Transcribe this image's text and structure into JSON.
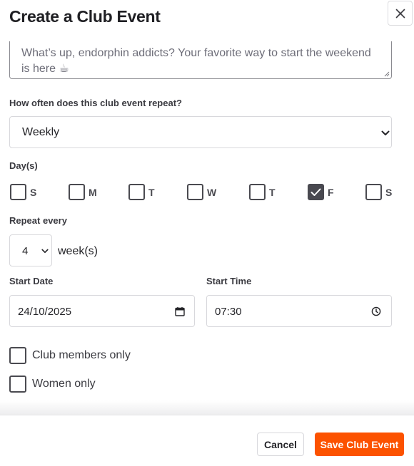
{
  "modal": {
    "title": "Create a Club Event",
    "close_icon": "close-icon"
  },
  "description": {
    "text": "What’s up, endorphin addicts? Your favorite way to start the weekend is here ☕"
  },
  "repeat": {
    "label": "How often does this club event repeat?",
    "selected": "Weekly"
  },
  "days": {
    "label": "Day(s)",
    "items": [
      {
        "letter": "S",
        "checked": false
      },
      {
        "letter": "M",
        "checked": false
      },
      {
        "letter": "T",
        "checked": false
      },
      {
        "letter": "W",
        "checked": false
      },
      {
        "letter": "T",
        "checked": false
      },
      {
        "letter": "F",
        "checked": true
      },
      {
        "letter": "S",
        "checked": false
      }
    ]
  },
  "repeat_every": {
    "label": "Repeat every",
    "value": "4",
    "unit": "week(s)"
  },
  "start_date": {
    "label": "Start Date",
    "value": "24/10/2025"
  },
  "start_time": {
    "label": "Start Time",
    "value": "07:30"
  },
  "options": [
    {
      "label": "Club members only",
      "checked": false
    },
    {
      "label": "Women only",
      "checked": false
    }
  ],
  "footer": {
    "cancel_label": "Cancel",
    "save_label": "Save Club Event"
  },
  "colors": {
    "accent": "#fc5200",
    "checkbox_checked": "#494950"
  }
}
